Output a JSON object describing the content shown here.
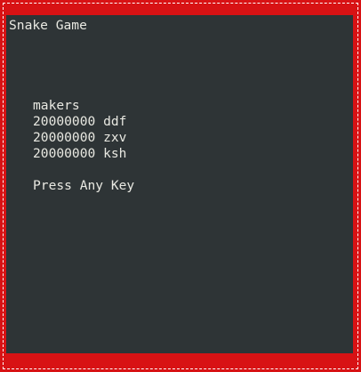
{
  "title": "Snake Game",
  "scoreboard": {
    "heading": "makers",
    "entries": [
      {
        "score": "20000000",
        "name": "ddf"
      },
      {
        "score": "20000000",
        "name": "zxv"
      },
      {
        "score": "20000000",
        "name": "ksh"
      }
    ]
  },
  "prompt": "Press Any Key",
  "colors": {
    "border": "#d81214",
    "terminal_background": "#2e3436",
    "text": "#e9e9e2"
  }
}
